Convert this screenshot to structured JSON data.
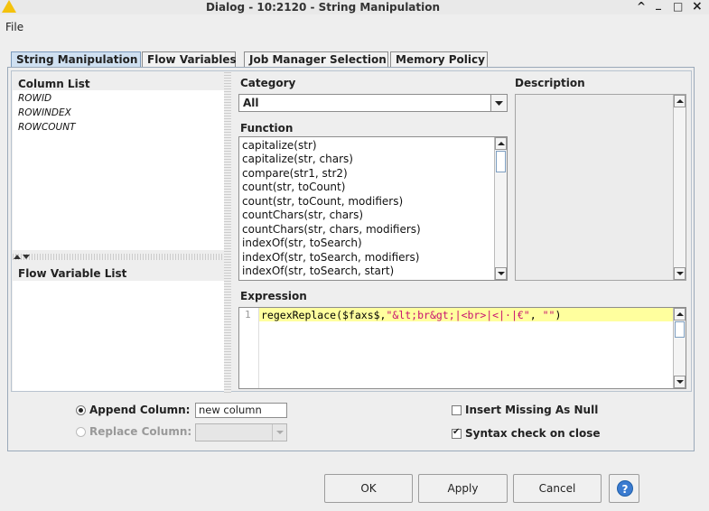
{
  "window": {
    "title": "Dialog - 10:2120 - String Manipulation",
    "controls": [
      "^",
      "_",
      "□",
      "×"
    ]
  },
  "menu": {
    "file": "File"
  },
  "tabs": [
    "String Manipulation",
    "Flow Variables",
    "Job Manager Selection",
    "Memory Policy"
  ],
  "column_list": {
    "label": "Column List",
    "items": [
      "ROWID",
      "ROWINDEX",
      "ROWCOUNT"
    ]
  },
  "flow_variable_list": {
    "label": "Flow Variable List"
  },
  "category": {
    "label": "Category",
    "value": "All"
  },
  "description": {
    "label": "Description"
  },
  "function": {
    "label": "Function",
    "items": [
      "capitalize(str)",
      "capitalize(str, chars)",
      "compare(str1, str2)",
      "count(str, toCount)",
      "count(str, toCount, modifiers)",
      "countChars(str, chars)",
      "countChars(str, chars, modifiers)",
      "indexOf(str, toSearch)",
      "indexOf(str, toSearch, modifiers)",
      "indexOf(str, toSearch, start)"
    ]
  },
  "expression": {
    "label": "Expression",
    "line_number": "1",
    "code_prefix": "regexReplace($faxs$,",
    "code_string1": "\"&lt;br&gt;|<br>|<|·|€\"",
    "code_sep": ", ",
    "code_string2": "\"\"",
    "code_suffix": ")"
  },
  "options": {
    "append_label": "Append Column:",
    "append_value": "new column",
    "replace_label": "Replace Column:",
    "insert_missing_label": "Insert Missing As Null",
    "insert_missing_checked": false,
    "syntax_check_label": "Syntax check on close",
    "syntax_check_checked": true
  },
  "buttons": {
    "ok": "OK",
    "apply": "Apply",
    "cancel": "Cancel",
    "help": "?"
  },
  "colors": {
    "highlight_line": "#ffff9e",
    "string_literal": "#c8116f",
    "active_tab": "#cfe0f1"
  }
}
